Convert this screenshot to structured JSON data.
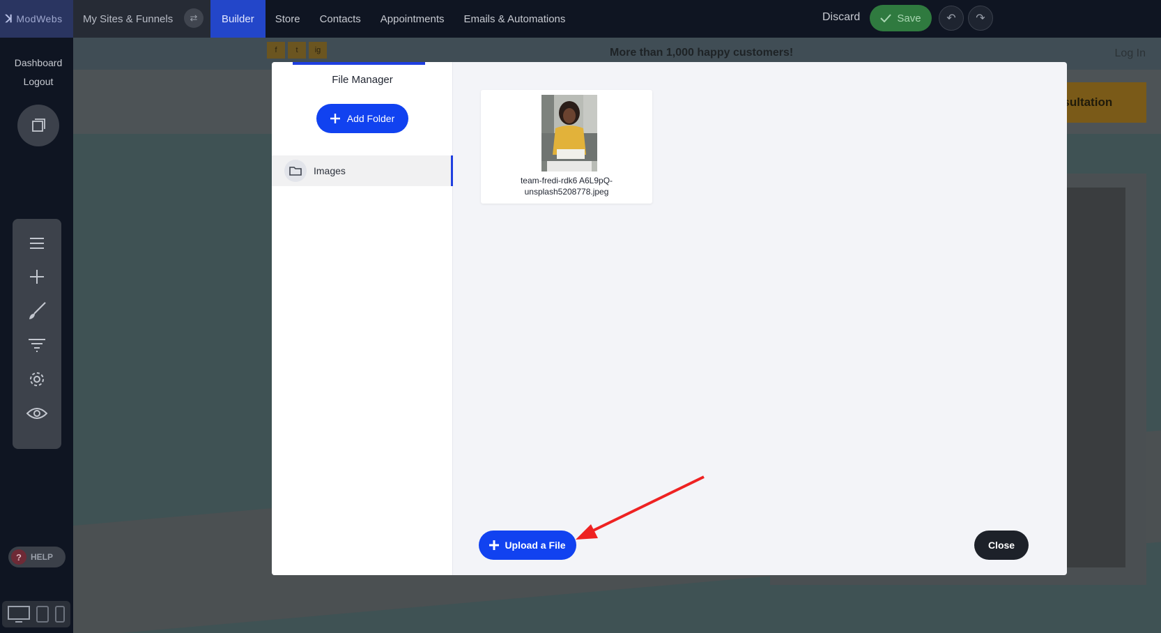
{
  "topbar": {
    "brand": "ModWebs",
    "sites_label": "My Sites & Funnels",
    "nav": [
      "Builder",
      "Store",
      "Contacts",
      "Appointments",
      "Emails & Automations"
    ],
    "active_nav": "Builder",
    "discard_label": "Discard",
    "save_label": "Save"
  },
  "sidebar": {
    "links": [
      "Dashboard",
      "Logout"
    ],
    "tools": [
      "menu-icon",
      "plus-icon",
      "brush-icon",
      "filter-icon",
      "gear-icon",
      "eye-icon"
    ],
    "help_label": "HELP",
    "devices": [
      "desktop-icon",
      "tablet-icon",
      "phone-icon"
    ]
  },
  "canvas": {
    "announcement": "More than 1,000 happy customers!",
    "login_label": "Log In",
    "cta_label": "nsultation",
    "social": [
      "f",
      "t",
      "ig"
    ]
  },
  "file_manager": {
    "title": "File Manager",
    "add_folder_label": "Add Folder",
    "folders": [
      {
        "name": "Images",
        "selected": true
      }
    ],
    "files": [
      {
        "name": "team-fredi-rdk6 A6L9pQ-unsplash5208778.jpeg"
      }
    ],
    "upload_label": "Upload a File",
    "close_label": "Close"
  },
  "colors": {
    "primary": "#1142f0",
    "save_green": "#2f7a3f",
    "topbar_bg": "#0f1522",
    "annotation_arrow": "#ee2222"
  }
}
